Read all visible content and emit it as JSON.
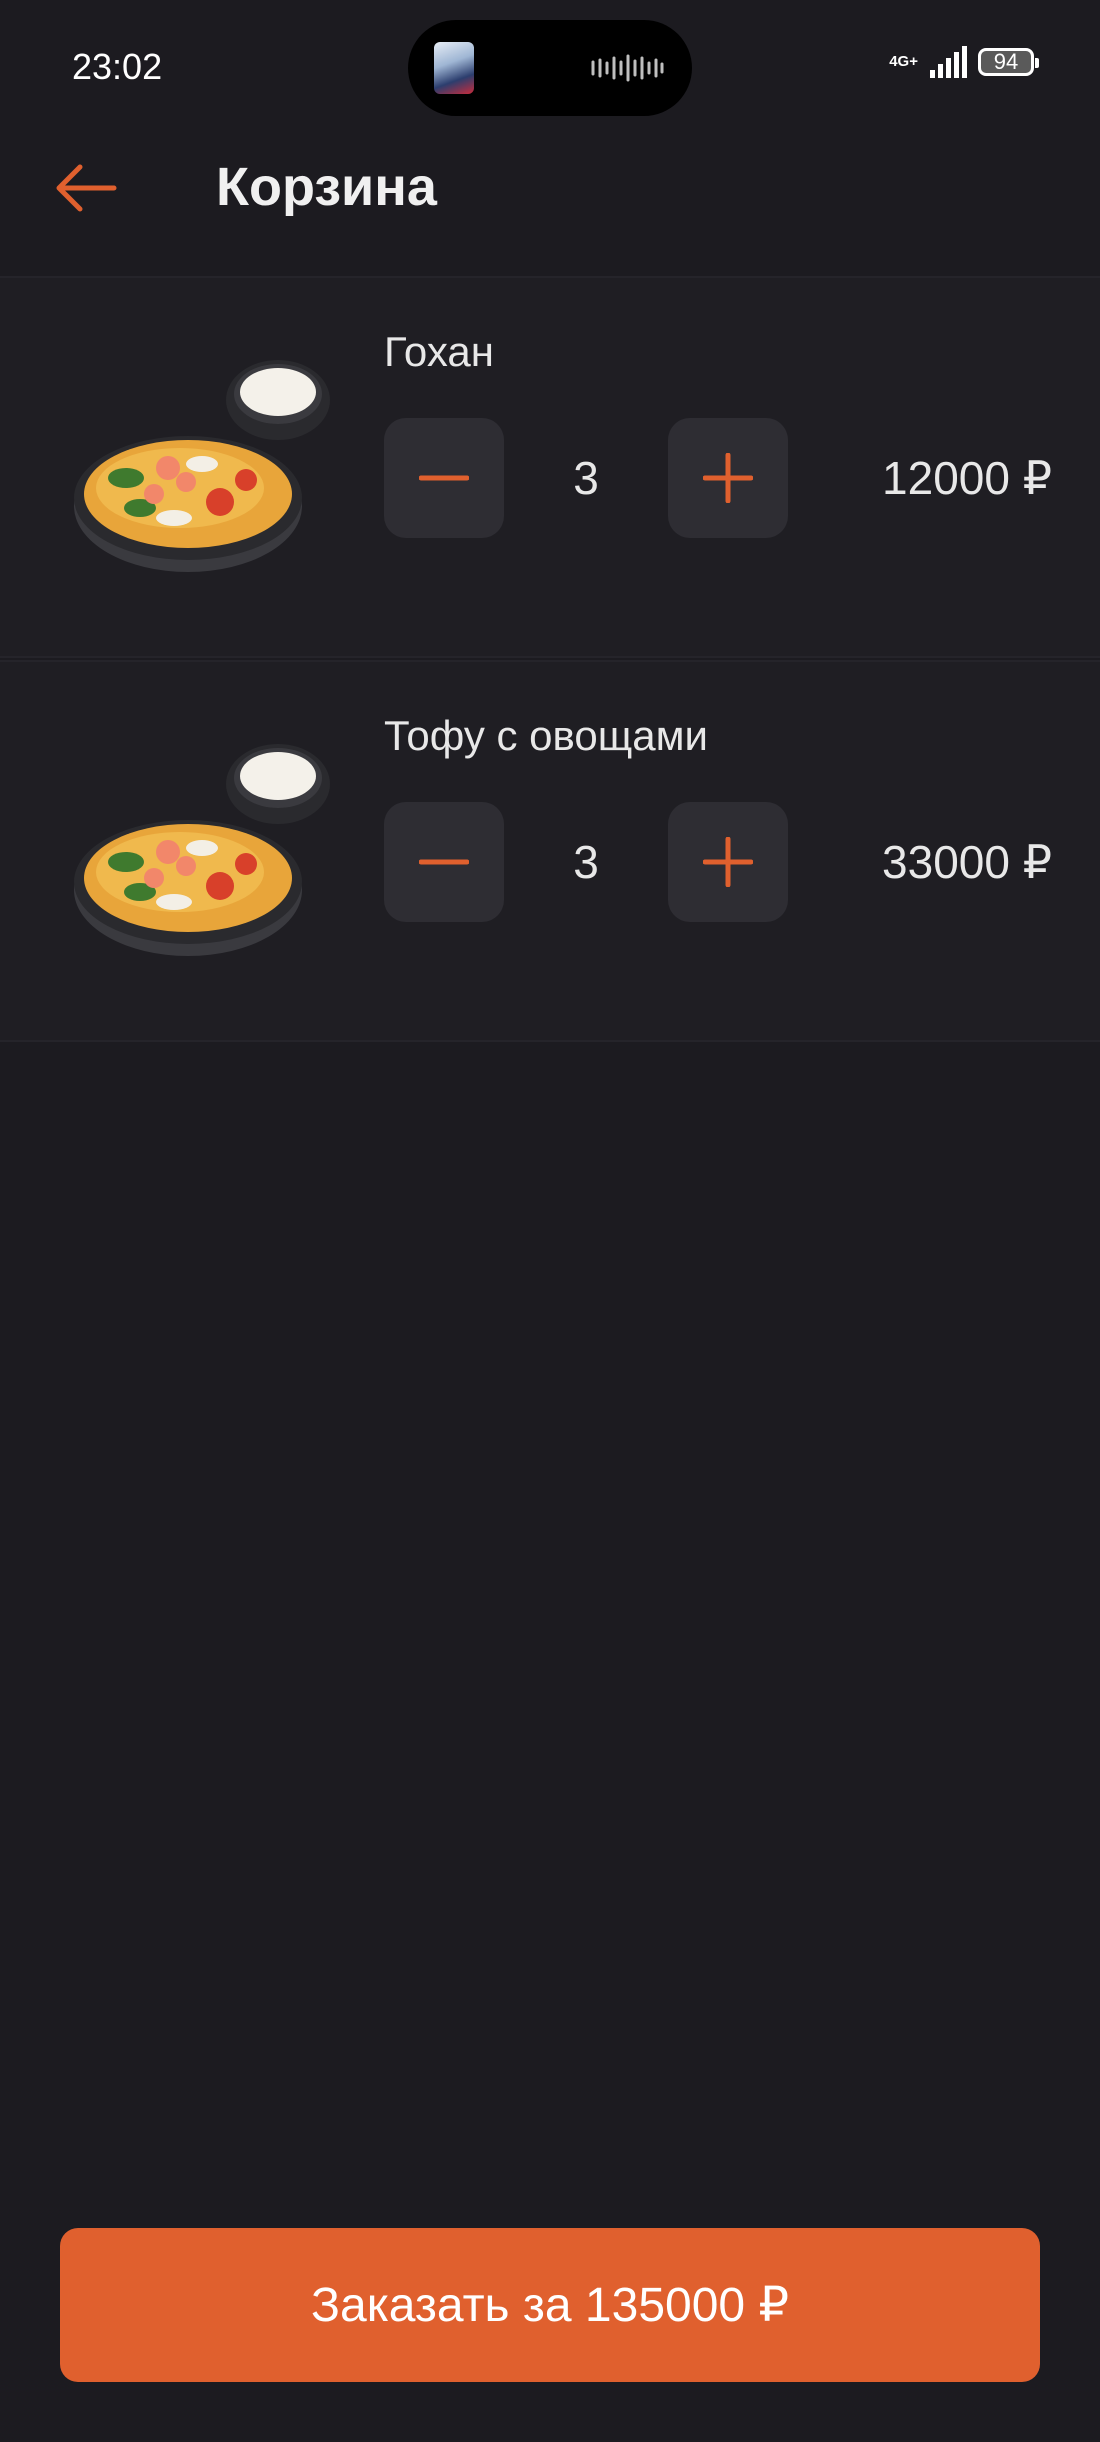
{
  "status_bar": {
    "time": "23:02",
    "network": "4G+",
    "battery": "94"
  },
  "header": {
    "title": "Корзина"
  },
  "cart": {
    "items": [
      {
        "name": "Гохан",
        "quantity": "3",
        "price": "12000 ₽"
      },
      {
        "name": "Тофу с овощами",
        "quantity": "3",
        "price": "33000 ₽"
      }
    ]
  },
  "order_button": {
    "label": "Заказать за 135000 ₽"
  },
  "colors": {
    "accent": "#e0602e",
    "background": "#1c1b20",
    "button_surface": "#2e2d33"
  },
  "icons": {
    "back": "arrow-left-icon",
    "minus": "minus-icon",
    "plus": "plus-icon"
  }
}
